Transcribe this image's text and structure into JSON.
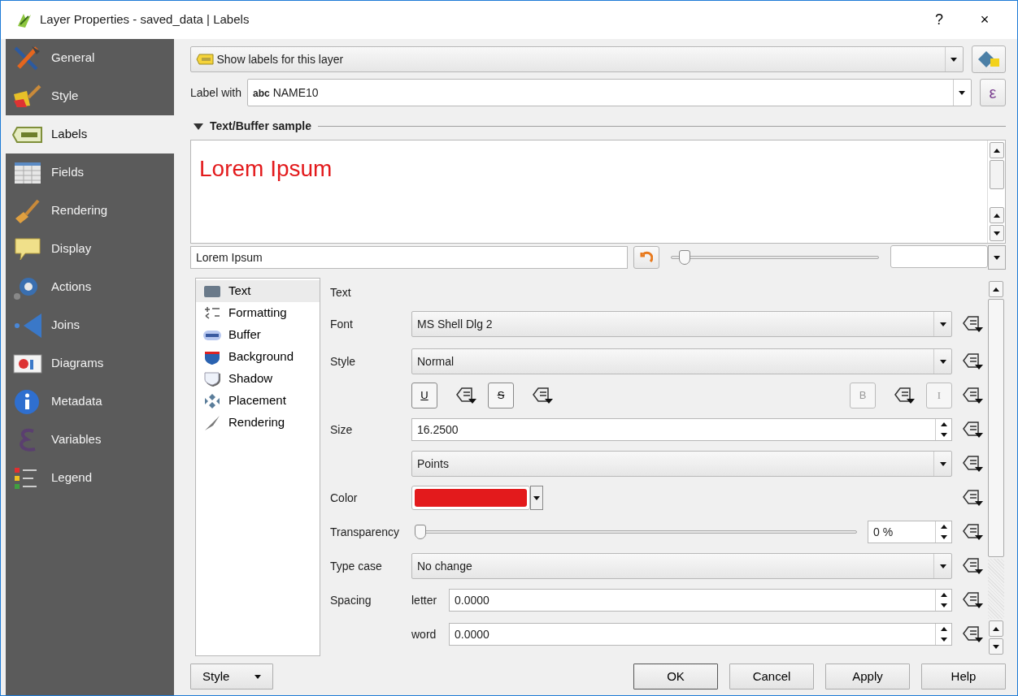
{
  "window": {
    "title": "Layer Properties - saved_data | Labels",
    "help": "?",
    "close": "×"
  },
  "sidebar": {
    "items": [
      {
        "label": "General",
        "selected": false
      },
      {
        "label": "Style",
        "selected": false
      },
      {
        "label": "Labels",
        "selected": true
      },
      {
        "label": "Fields",
        "selected": false
      },
      {
        "label": "Rendering",
        "selected": false
      },
      {
        "label": "Display",
        "selected": false
      },
      {
        "label": "Actions",
        "selected": false
      },
      {
        "label": "Joins",
        "selected": false
      },
      {
        "label": "Diagrams",
        "selected": false
      },
      {
        "label": "Metadata",
        "selected": false
      },
      {
        "label": "Variables",
        "selected": false
      },
      {
        "label": "Legend",
        "selected": false
      }
    ]
  },
  "mode": {
    "value": "Show labels for this layer"
  },
  "label_with": {
    "label": "Label with",
    "type_tag": "abc",
    "value": "NAME10",
    "expression": "ε"
  },
  "sample": {
    "heading": "Text/Buffer sample",
    "expanded": true,
    "preview": "Lorem Ipsum",
    "input": "Lorem Ipsum",
    "zoom": {
      "level": 0.04
    }
  },
  "subnav": {
    "items": [
      {
        "label": "Text",
        "selected": true
      },
      {
        "label": "Formatting",
        "selected": false
      },
      {
        "label": "Buffer",
        "selected": false
      },
      {
        "label": "Background",
        "selected": false
      },
      {
        "label": "Shadow",
        "selected": false
      },
      {
        "label": "Placement",
        "selected": false
      },
      {
        "label": "Rendering",
        "selected": false
      }
    ]
  },
  "text_section": {
    "heading": "Text",
    "rows": [
      {
        "kind": "combo",
        "label": "Font",
        "value": "MS Shell Dlg 2"
      },
      {
        "kind": "combo",
        "label": "Style",
        "value": "Normal"
      },
      {
        "kind": "format",
        "buttons": [
          {
            "label": "U",
            "disabled": false
          },
          {
            "label": "S",
            "disabled": false
          },
          {
            "label": "B",
            "disabled": true
          },
          {
            "label": "I",
            "disabled": true
          }
        ]
      },
      {
        "kind": "spin",
        "label": "Size",
        "value": "16.2500"
      },
      {
        "kind": "combo",
        "value": "Points"
      },
      {
        "kind": "color",
        "label": "Color",
        "color": "#e31a1c"
      },
      {
        "kind": "slider",
        "label": "Transparency",
        "level": 0,
        "value": "0 %"
      },
      {
        "kind": "combo",
        "label": "Type case",
        "value": "No change"
      },
      {
        "kind": "spin",
        "label": "Spacing",
        "sublabel": "letter",
        "value": "0.0000"
      },
      {
        "kind": "spin",
        "sublabel": "word",
        "value": "0.0000"
      }
    ]
  },
  "footer": {
    "style_button": "Style",
    "buttons": [
      "OK",
      "Cancel",
      "Apply",
      "Help"
    ]
  }
}
